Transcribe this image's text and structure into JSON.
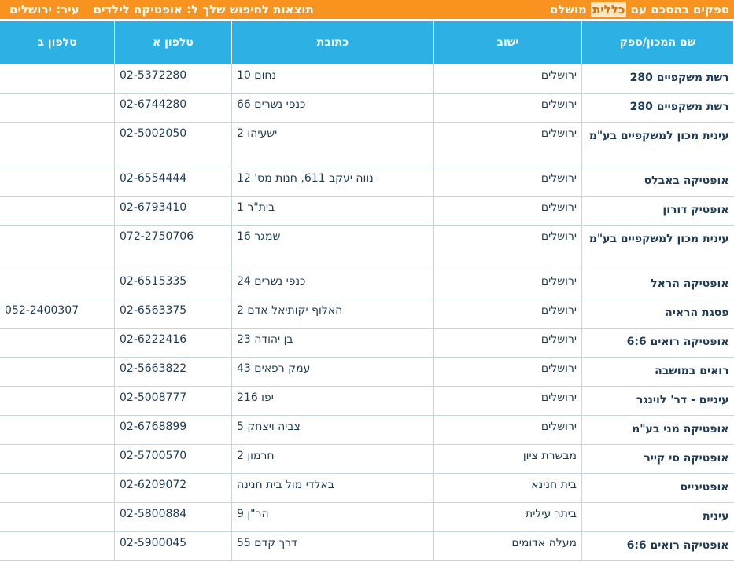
{
  "header": {
    "title_pre": "ספקים בהסכם עם ",
    "title_highlight": "כללית",
    "title_post": " מושלם",
    "search_label": "תוצאות לחיפוש שלך ל: אופטיקה לילדים",
    "city_label": "עיר: ירושלים"
  },
  "columns": {
    "name": "שם המכון/ספק",
    "city": "ישוב",
    "address": "כתובת",
    "phone_a": "טלפון א",
    "phone_b": "טלפון ב"
  },
  "rows": [
    {
      "name": "רשת משקפיים 280",
      "city": "ירושלים",
      "address": "נחום 10",
      "phone_a": "02-5372280",
      "phone_b": ""
    },
    {
      "name": "רשת משקפיים 280",
      "city": "ירושלים",
      "address": "כנפי נשרים 66",
      "phone_a": "02-6744280",
      "phone_b": ""
    },
    {
      "name": "עינית מכון למשקפיים בע\"מ",
      "city": "ירושלים",
      "address": "ישעיהו 2",
      "phone_a": "02-5002050",
      "phone_b": ""
    },
    {
      "name": "אופטיקה באבלס",
      "city": "ירושלים",
      "address": "נווה יעקב 611, חנות מס' 12",
      "phone_a": "02-6554444",
      "phone_b": ""
    },
    {
      "name": "אופטיק דורון",
      "city": "ירושלים",
      "address": "בית\"ר 1",
      "phone_a": "02-6793410",
      "phone_b": ""
    },
    {
      "name": "עינית מכון למשקפיים בע\"מ",
      "city": "ירושלים",
      "address": "שמגר 16",
      "phone_a": "072-2750706",
      "phone_b": ""
    },
    {
      "name": "אופטיקה הראל",
      "city": "ירושלים",
      "address": "כנפי נשרים 24",
      "phone_a": "02-6515335",
      "phone_b": ""
    },
    {
      "name": "פסגת הראיה",
      "city": "ירושלים",
      "address": "האלוף יקותיאל אדם 2",
      "phone_a": "02-6563375",
      "phone_b": "052-2400307"
    },
    {
      "name": "אופטיקה רואים 6:6",
      "city": "ירושלים",
      "address": "בן יהודה 23",
      "phone_a": "02-6222416",
      "phone_b": ""
    },
    {
      "name": "רואים במושבה",
      "city": "ירושלים",
      "address": "עמק רפאים 43",
      "phone_a": "02-5663822",
      "phone_b": ""
    },
    {
      "name": "עיניים - דר' לוינגר",
      "city": "ירושלים",
      "address": "יפו 216",
      "phone_a": "02-5008777",
      "phone_b": ""
    },
    {
      "name": "אופטיקה מני בע\"מ",
      "city": "ירושלים",
      "address": "צביה ויצחק 5",
      "phone_a": "02-6768899",
      "phone_b": ""
    },
    {
      "name": "אופטיקה סי קייר",
      "city": "מבשרת ציון",
      "address": "חרמון 2",
      "phone_a": "02-5700570",
      "phone_b": ""
    },
    {
      "name": "אופטינייס",
      "city": "בית חנינא",
      "address": "באלדי מול בית חנינה",
      "phone_a": "02-6209072",
      "phone_b": ""
    },
    {
      "name": "עינית",
      "city": "ביתר עילית",
      "address": "הר\"ן 9",
      "phone_a": "02-5800884",
      "phone_b": ""
    },
    {
      "name": "אופטיקה רואים 6:6",
      "city": "מעלה אדומים",
      "address": "דרך קדם 55",
      "phone_a": "02-5900045",
      "phone_b": ""
    }
  ],
  "colors": {
    "header_bar": "#f7931e",
    "table_header": "#2db1e4",
    "name_text": "#0d2f6b"
  }
}
